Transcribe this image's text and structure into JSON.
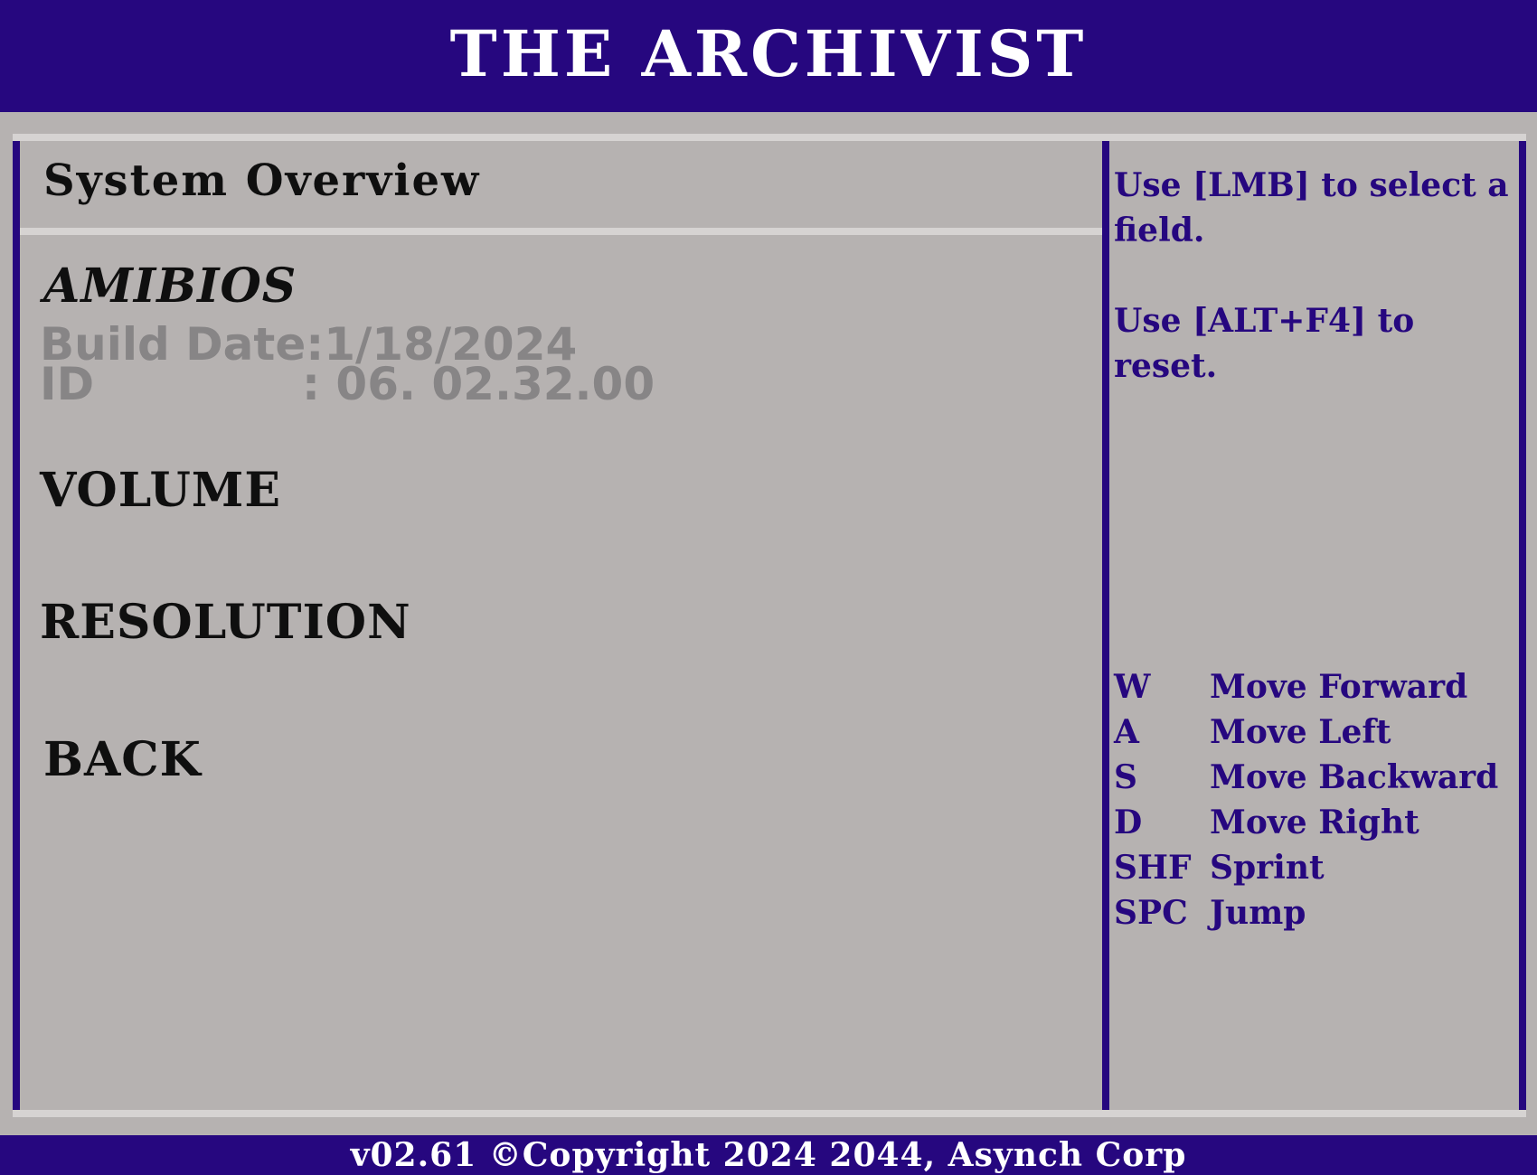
{
  "app": {
    "title": "THE ARCHIVIST"
  },
  "colors": {
    "accent": "#26077f",
    "panel": "#b6b2b1",
    "rule": "#d6d3d2",
    "dim_text": "#878586"
  },
  "main": {
    "section_title": "System Overview",
    "bios": {
      "heading": "AMIBIOS",
      "build_label": "Build Date",
      "build_value": "1/18/2024",
      "id_label": "ID",
      "id_value": ": 06. 02.32.00"
    },
    "menu": {
      "volume": "VOLUME",
      "resolution": "RESOLUTION",
      "back": "BACK"
    }
  },
  "help": {
    "line1": "Use [LMB] to select a field.",
    "line2": "Use [ALT+F4] to reset.",
    "keys": [
      {
        "key": "W",
        "action": "Move Forward"
      },
      {
        "key": "A",
        "action": "Move Left"
      },
      {
        "key": "S",
        "action": "Move Backward"
      },
      {
        "key": "D",
        "action": "Move Right"
      },
      {
        "key": "SHF",
        "action": "Sprint"
      },
      {
        "key": "SPC",
        "action": "Jump"
      }
    ]
  },
  "footer": {
    "text": "v02.61 ©Copyright 2024 2044, Asynch Corp"
  }
}
